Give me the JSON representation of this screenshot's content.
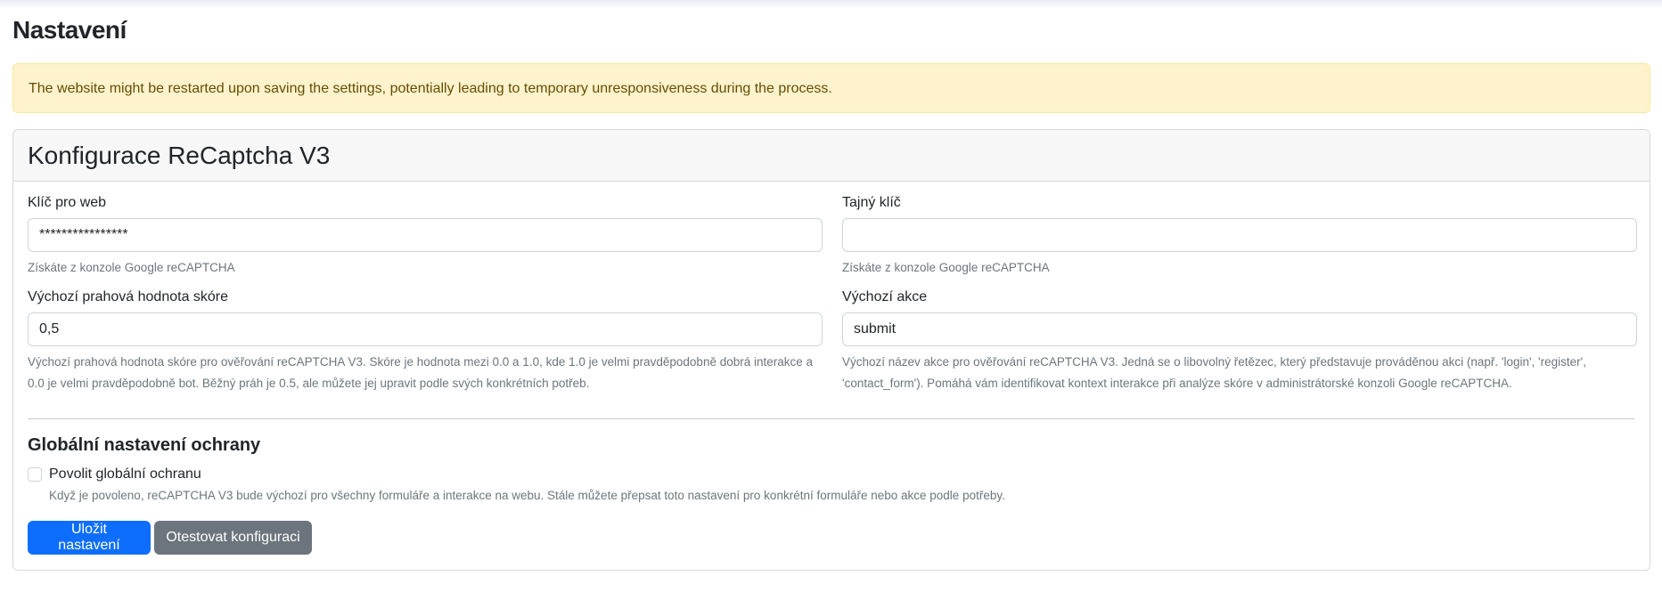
{
  "page": {
    "title": "Nastavení"
  },
  "alert": {
    "text": "The website might be restarted upon saving the settings, potentially leading to temporary unresponsiveness during the process."
  },
  "card": {
    "title": "Konfigurace ReCaptcha V3",
    "site_key": {
      "label": "Klíč pro web",
      "value": "****************",
      "help": "Získáte z konzole Google reCAPTCHA"
    },
    "secret_key": {
      "label": "Tajný klíč",
      "value": "",
      "help": "Získáte z konzole Google reCAPTCHA"
    },
    "threshold": {
      "label": "Výchozí prahová hodnota skóre",
      "value": "0,5",
      "help": "Výchozí prahová hodnota skóre pro ověřování reCAPTCHA V3. Skóre je hodnota mezi 0.0 a 1.0, kde 1.0 je velmi pravděpodobně dobrá interakce a 0.0 je velmi pravděpodobně bot. Běžný práh je 0.5, ale můžete jej upravit podle svých konkrétních potřeb."
    },
    "action": {
      "label": "Výchozí akce",
      "value": "submit",
      "help": "Výchozí název akce pro ověřování reCAPTCHA V3. Jedná se o libovolný řetězec, který představuje prováděnou akci (např. 'login', 'register', 'contact_form'). Pomáhá vám identifikovat kontext interakce při analýze skóre v administrátorské konzoli Google reCAPTCHA."
    },
    "global": {
      "title": "Globální nastavení ochrany",
      "checkbox_label": "Povolit globální ochranu",
      "checked": false,
      "help": "Když je povoleno, reCAPTCHA V3 bude výchozí pro všechny formuláře a interakce na webu. Stále můžete přepsat toto nastavení pro konkrétní formuláře nebo akce podle potřeby."
    },
    "buttons": {
      "save": "Uložit nastavení",
      "test": "Otestovat konfiguraci"
    }
  },
  "colors": {
    "primary": "#0d6efd",
    "secondary": "#6c757d",
    "alert_bg": "#fff3cd",
    "alert_text": "#664d03"
  }
}
